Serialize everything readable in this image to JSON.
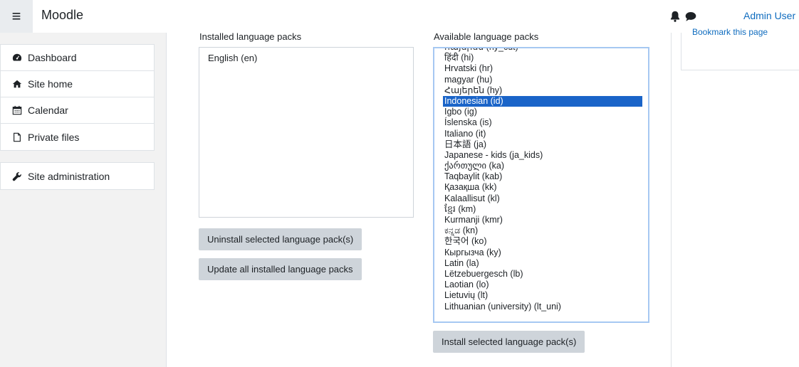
{
  "navbar": {
    "menu_icon": "hamburger-icon",
    "brand": "Moodle",
    "notifications_icon": "bell-icon",
    "messages_icon": "chat-icon",
    "user_name": "Admin User"
  },
  "sidebar": {
    "items": [
      {
        "label": "Dashboard",
        "icon": "dashboard-icon"
      },
      {
        "label": "Site home",
        "icon": "home-icon"
      },
      {
        "label": "Calendar",
        "icon": "calendar-icon"
      },
      {
        "label": "Private files",
        "icon": "file-icon"
      }
    ],
    "admin_item": {
      "label": "Site administration",
      "icon": "wrench-icon"
    }
  },
  "main": {
    "installed_label": "Installed language packs",
    "installed_packs": [
      "English (en)"
    ],
    "available_label": "Available language packs",
    "available_packs": [
      "հայերեն (hy_cut)",
      "हिंदी (hi)",
      "Hrvatski (hr)",
      "magyar (hu)",
      "Հայերեն (hy)",
      "Indonesian (id)",
      "Igbo (ig)",
      "Íslenska (is)",
      "Italiano (it)",
      "日本語 (ja)",
      "Japanese - kids (ja_kids)",
      "ქართული (ka)",
      "Taqbaylit (kab)",
      "Қазақша (kk)",
      "Kalaallisut (kl)",
      "ខ្មែរ (km)",
      "Kurmanji (kmr)",
      "ಕನ್ನಡ (kn)",
      "한국어 (ko)",
      "Кыргызча (ky)",
      "Latin (la)",
      "Lëtzebuergesch (lb)",
      "Laotian (lo)",
      "Lietuvių (lt)",
      "Lithuanian (university) (lt_uni)"
    ],
    "selected_pack": "Indonesian (id)",
    "uninstall_button": "Uninstall selected language pack(s)",
    "update_button": "Update all installed language packs",
    "install_button": "Install selected language pack(s)"
  },
  "right_block": {
    "bookmark_link": "Bookmark this page"
  },
  "colors": {
    "accent": "#0f6cbf",
    "selection": "#1a64c8",
    "button_bg": "#ced4da",
    "sidebar_bg": "#f2f2f2"
  }
}
